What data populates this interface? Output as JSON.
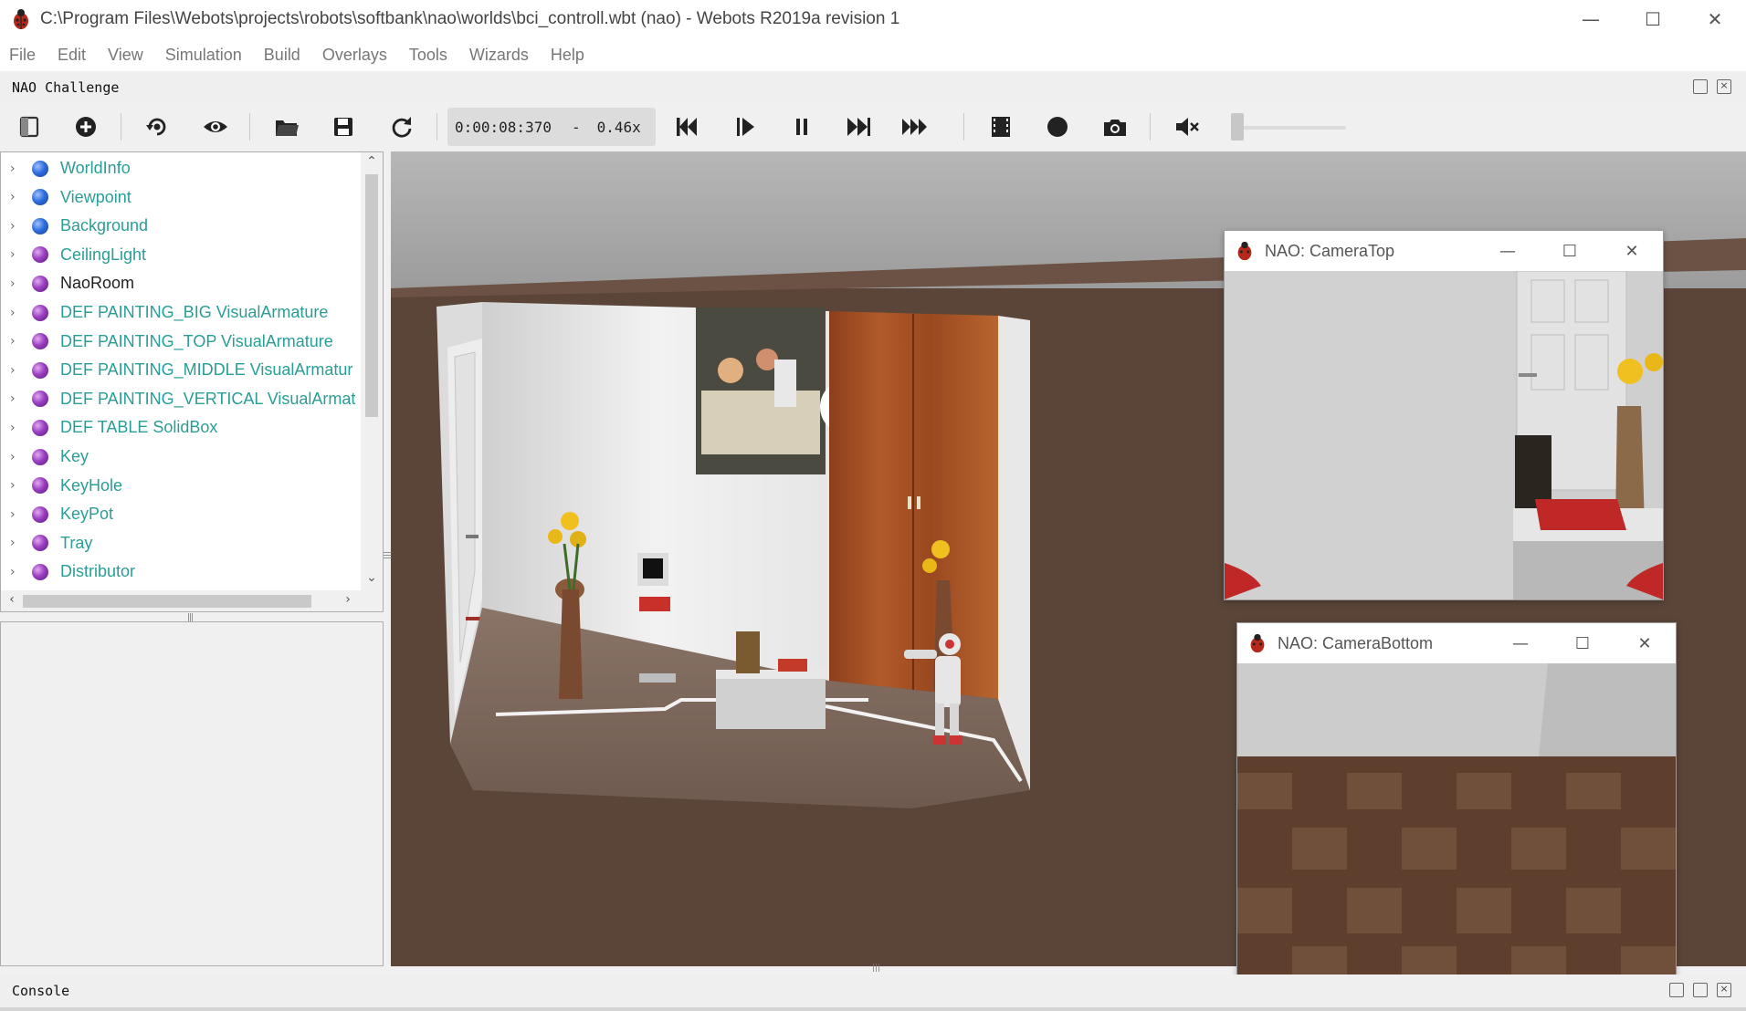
{
  "window": {
    "title": "C:\\Program Files\\Webots\\projects\\robots\\softbank\\nao\\worlds\\bci_controll.wbt (nao) - Webots R2019a revision 1",
    "controls": [
      "—",
      "☐",
      "✕"
    ]
  },
  "menu": [
    "File",
    "Edit",
    "View",
    "Simulation",
    "Build",
    "Overlays",
    "Tools",
    "Wizards",
    "Help"
  ],
  "dock": {
    "title": "NAO Challenge"
  },
  "toolbar": {
    "time": "0:00:08:370",
    "dash": "-",
    "speed": "0.46x",
    "icons": [
      "toggle-panel-icon",
      "add-node-icon",
      "reset-viewpoint-icon",
      "eye-icon",
      "open-file-icon",
      "save-icon",
      "reload-icon",
      "step-back-icon",
      "play-icon",
      "pause-icon",
      "fast-forward-icon",
      "fastest-icon",
      "record-video-icon",
      "record-circle-icon",
      "screenshot-icon",
      "mute-icon"
    ],
    "volume_level": 0
  },
  "scene_tree": {
    "items": [
      {
        "label": "WorldInfo",
        "color": "blue",
        "dark": false
      },
      {
        "label": "Viewpoint",
        "color": "blue",
        "dark": false
      },
      {
        "label": "Background",
        "color": "blue",
        "dark": false
      },
      {
        "label": "CeilingLight",
        "color": "purple",
        "dark": false
      },
      {
        "label": "NaoRoom",
        "color": "purple",
        "dark": true
      },
      {
        "label": "DEF PAINTING_BIG VisualArmature",
        "color": "purple",
        "dark": false
      },
      {
        "label": "DEF PAINTING_TOP VisualArmature",
        "color": "purple",
        "dark": false
      },
      {
        "label": "DEF PAINTING_MIDDLE VisualArmatur",
        "color": "purple",
        "dark": false
      },
      {
        "label": "DEF PAINTING_VERTICAL VisualArmat",
        "color": "purple",
        "dark": false
      },
      {
        "label": "DEF TABLE SolidBox",
        "color": "purple",
        "dark": false
      },
      {
        "label": "Key",
        "color": "purple",
        "dark": false
      },
      {
        "label": "KeyHole",
        "color": "purple",
        "dark": false
      },
      {
        "label": "KeyPot",
        "color": "purple",
        "dark": false
      },
      {
        "label": "Tray",
        "color": "purple",
        "dark": false
      },
      {
        "label": "Distributor",
        "color": "purple",
        "dark": false
      }
    ]
  },
  "cameras": {
    "top": {
      "title": "NAO: CameraTop"
    },
    "bottom": {
      "title": "NAO: CameraBottom"
    }
  },
  "console": {
    "title": "Console"
  },
  "colors": {
    "tree_text": "#2a9d96",
    "viewport_bg": "#5a4538"
  }
}
